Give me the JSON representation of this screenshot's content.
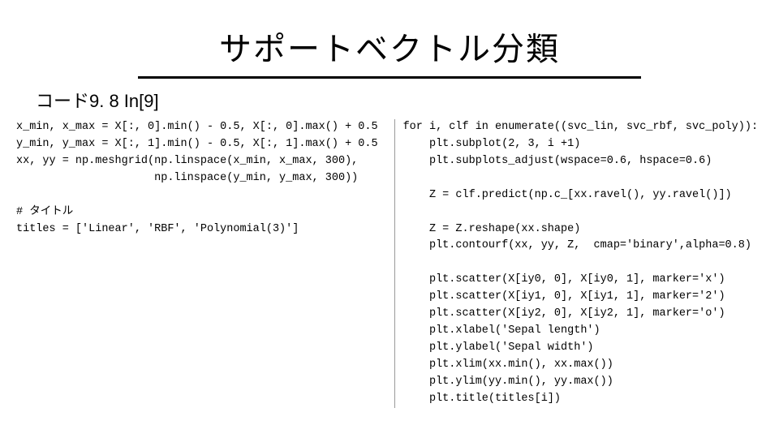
{
  "title": "サポートベクトル分類",
  "subtitle": "コード9. 8 In[9]",
  "code_left": "x_min, x_max = X[:, 0].min() - 0.5, X[:, 0].max() + 0.5\ny_min, y_max = X[:, 1].min() - 0.5, X[:, 1].max() + 0.5\nxx, yy = np.meshgrid(np.linspace(x_min, x_max, 300),\n                     np.linspace(y_min, y_max, 300))\n\n# タイトル\ntitles = ['Linear', 'RBF', 'Polynomial(3)']",
  "code_right": "for i, clf in enumerate((svc_lin, svc_rbf, svc_poly)):\n    plt.subplot(2, 3, i +1)\n    plt.subplots_adjust(wspace=0.6, hspace=0.6)\n\n    Z = clf.predict(np.c_[xx.ravel(), yy.ravel()])\n\n    Z = Z.reshape(xx.shape)\n    plt.contourf(xx, yy, Z,  cmap='binary',alpha=0.8)\n\n    plt.scatter(X[iy0, 0], X[iy0, 1], marker='x')\n    plt.scatter(X[iy1, 0], X[iy1, 1], marker='2')\n    plt.scatter(X[iy2, 0], X[iy2, 1], marker='o')\n    plt.xlabel('Sepal length')\n    plt.ylabel('Sepal width')\n    plt.xlim(xx.min(), xx.max())\n    plt.ylim(yy.min(), yy.max())\n    plt.title(titles[i])"
}
